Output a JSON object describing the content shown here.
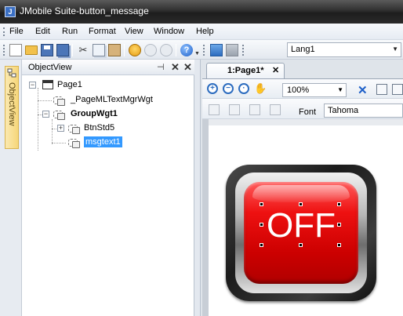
{
  "window": {
    "title": "JMobile Suite-button_message"
  },
  "menu": {
    "items": [
      "File",
      "Edit",
      "Run",
      "Format",
      "View",
      "Window",
      "Help"
    ]
  },
  "toolbar": {
    "language": "Lang1"
  },
  "side_tab": {
    "label": "ObjectView"
  },
  "object_view": {
    "title": "ObjectView",
    "tree": {
      "page": "Page1",
      "ml_text_mgr": "_PageMLTextMgrWgt",
      "group": "GroupWgt1",
      "button": "BtnStd5",
      "selected": "msgtext1"
    }
  },
  "document": {
    "tab_label": "1:Page1*",
    "zoom": "100%",
    "font_label": "Font",
    "font_value": "Tahoma"
  },
  "widget": {
    "button_text": "OFF"
  },
  "colors": {
    "selection": "#3399ff",
    "button_red": "#ee1111",
    "titlebar": "#2f2f2f"
  }
}
